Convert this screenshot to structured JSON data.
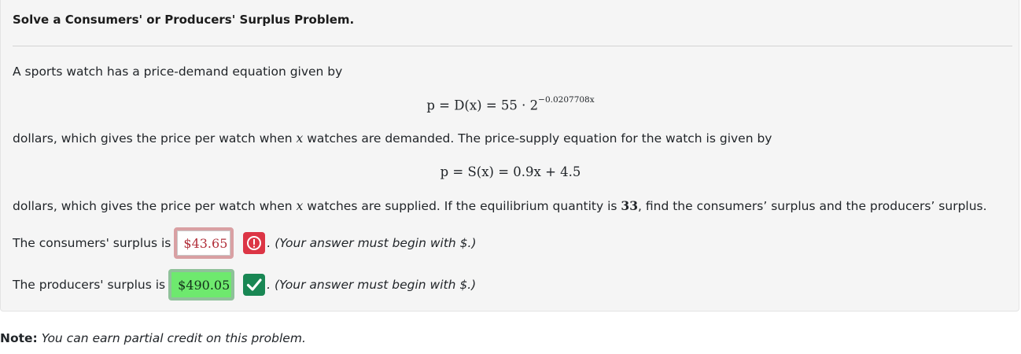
{
  "problem": {
    "title": "Solve a Consumers' or Producers' Surplus Problem.",
    "intro": "A sports watch has a price-demand equation given by",
    "demand_equation": {
      "lhs": "p = D(x) = 55 · 2",
      "exponent": "−0.0207708x"
    },
    "after_demand": {
      "before_var": "dollars, which gives the price per watch when ",
      "var": "x",
      "after_var": " watches are demanded. The price-supply equation for the watch is given by"
    },
    "supply_equation": "p = S(x) = 0.9x + 4.5",
    "after_supply": {
      "before_var": "dollars, which gives the price per watch when ",
      "var": "x",
      "mid": " watches are supplied. If the equilibrium quantity is ",
      "quantity": "33",
      "end": ", find the consumers’ surplus and the producers’ surplus."
    }
  },
  "answers": {
    "consumers": {
      "label": "The consumers' surplus is",
      "value": "$43.65",
      "status": "incorrect",
      "hint": ". (Your answer must begin with $.)"
    },
    "producers": {
      "label": "The producers' surplus is",
      "value": "$490.05",
      "status": "correct",
      "hint": ". (Your answer must begin with $.)"
    }
  },
  "note": {
    "label": "Note:",
    "text": "You can earn partial credit on this problem."
  },
  "colors": {
    "incorrect": "#dc3545",
    "correct": "#198754",
    "correct_fill": "#6ee96e"
  },
  "icons": {
    "incorrect": "exclamation-circle-icon",
    "correct": "check-icon"
  }
}
